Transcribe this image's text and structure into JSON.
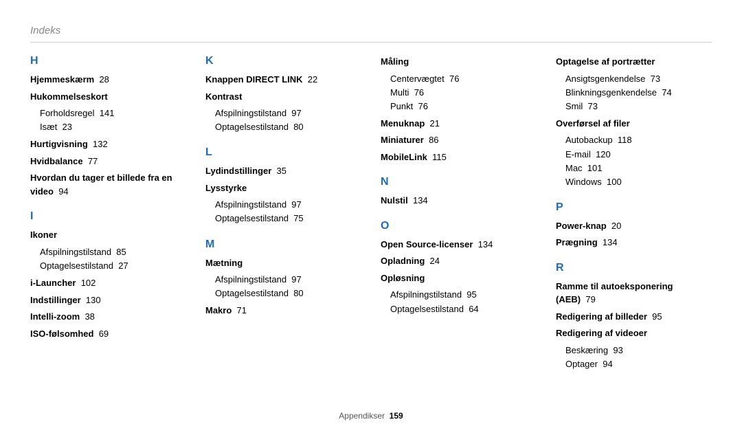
{
  "header": "Indeks",
  "footer": {
    "label": "Appendikser",
    "page": "159"
  },
  "columns": [
    {
      "sections": [
        {
          "letter": "H",
          "entries": [
            {
              "label": "Hjemmeskærm",
              "page": "28"
            },
            {
              "label": "Hukommelseskort",
              "subs": [
                {
                  "label": "Forholdsregel",
                  "page": "141"
                },
                {
                  "label": "Isæt",
                  "page": "23"
                }
              ]
            },
            {
              "label": "Hurtigvisning",
              "page": "132"
            },
            {
              "label": "Hvidbalance",
              "page": "77"
            },
            {
              "label": "Hvordan du tager et billede fra en video",
              "page": "94"
            }
          ]
        },
        {
          "letter": "I",
          "entries": [
            {
              "label": "Ikoner",
              "subs": [
                {
                  "label": "Afspilningstilstand",
                  "page": "85"
                },
                {
                  "label": "Optagelsestilstand",
                  "page": "27"
                }
              ]
            },
            {
              "label": "i-Launcher",
              "page": "102"
            },
            {
              "label": "Indstillinger",
              "page": "130"
            },
            {
              "label": "Intelli-zoom",
              "page": "38"
            },
            {
              "label": "ISO-følsomhed",
              "page": "69"
            }
          ]
        }
      ]
    },
    {
      "sections": [
        {
          "letter": "K",
          "entries": [
            {
              "label": "Knappen DIRECT LINK",
              "page": "22"
            },
            {
              "label": "Kontrast",
              "subs": [
                {
                  "label": "Afspilningstilstand",
                  "page": "97"
                },
                {
                  "label": "Optagelsestilstand",
                  "page": "80"
                }
              ]
            }
          ]
        },
        {
          "letter": "L",
          "entries": [
            {
              "label": "Lydindstillinger",
              "page": "35"
            },
            {
              "label": "Lysstyrke",
              "subs": [
                {
                  "label": "Afspilningstilstand",
                  "page": "97"
                },
                {
                  "label": "Optagelsestilstand",
                  "page": "75"
                }
              ]
            }
          ]
        },
        {
          "letter": "M",
          "entries": [
            {
              "label": "Mætning",
              "subs": [
                {
                  "label": "Afspilningstilstand",
                  "page": "97"
                },
                {
                  "label": "Optagelsestilstand",
                  "page": "80"
                }
              ]
            },
            {
              "label": "Makro",
              "page": "71"
            }
          ]
        }
      ]
    },
    {
      "sections": [
        {
          "letter": "",
          "entries": [
            {
              "label": "Måling",
              "subs": [
                {
                  "label": "Centervægtet",
                  "page": "76"
                },
                {
                  "label": "Multi",
                  "page": "76"
                },
                {
                  "label": "Punkt",
                  "page": "76"
                }
              ]
            },
            {
              "label": "Menuknap",
              "page": "21"
            },
            {
              "label": "Miniaturer",
              "page": "86"
            },
            {
              "label": "MobileLink",
              "page": "115"
            }
          ]
        },
        {
          "letter": "N",
          "entries": [
            {
              "label": "Nulstil",
              "page": "134"
            }
          ]
        },
        {
          "letter": "O",
          "entries": [
            {
              "label": "Open Source-licenser",
              "page": "134"
            },
            {
              "label": "Opladning",
              "page": "24"
            },
            {
              "label": "Opløsning",
              "subs": [
                {
                  "label": "Afspilningstilstand",
                  "page": "95"
                },
                {
                  "label": "Optagelsestilstand",
                  "page": "64"
                }
              ]
            }
          ]
        }
      ]
    },
    {
      "sections": [
        {
          "letter": "",
          "entries": [
            {
              "label": "Optagelse af portrætter",
              "subs": [
                {
                  "label": "Ansigtsgenkendelse",
                  "page": "73"
                },
                {
                  "label": "Blinkningsgenkendelse",
                  "page": "74"
                },
                {
                  "label": "Smil",
                  "page": "73"
                }
              ]
            },
            {
              "label": "Overførsel af filer",
              "subs": [
                {
                  "label": "Autobackup",
                  "page": "118"
                },
                {
                  "label": "E-mail",
                  "page": "120"
                },
                {
                  "label": "Mac",
                  "page": "101"
                },
                {
                  "label": "Windows",
                  "page": "100"
                }
              ]
            }
          ]
        },
        {
          "letter": "P",
          "entries": [
            {
              "label": "Power-knap",
              "page": "20"
            },
            {
              "label": "Prægning",
              "page": "134"
            }
          ]
        },
        {
          "letter": "R",
          "entries": [
            {
              "label": "Ramme til autoeksponering (AEB)",
              "page": "79"
            },
            {
              "label": "Redigering af billeder",
              "page": "95"
            },
            {
              "label": "Redigering af videoer",
              "subs": [
                {
                  "label": "Beskæring",
                  "page": "93"
                },
                {
                  "label": "Optager",
                  "page": "94"
                }
              ]
            }
          ]
        }
      ]
    }
  ]
}
